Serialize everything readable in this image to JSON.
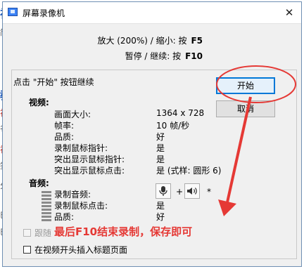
{
  "background": {
    "fragments": [
      "视",
      "简",
      "教",
      "视",
      "名",
      "视",
      "签",
      "分",
      "巳",
      "巳"
    ]
  },
  "dialog": {
    "title": "屏幕录像机",
    "close_glyph": "✕",
    "hotkeys": {
      "zoom_label": "放大 (200%) / 缩小: 按",
      "zoom_key": "F5",
      "pause_label": "暂停 / 继续: 按",
      "pause_key": "F10"
    },
    "prompt": "点击 \"开始\" 按钮继续",
    "buttons": {
      "start": "开始",
      "cancel": "取消"
    },
    "video": {
      "heading": "视频:",
      "rows": [
        {
          "label": "画面大小:",
          "value": "1364 x 728"
        },
        {
          "label": "帧率:",
          "value": "10 帧/秒"
        },
        {
          "label": "品质:",
          "value": "好"
        },
        {
          "label": "录制鼠标指针:",
          "value": "是"
        },
        {
          "label": "突出显示鼠标指针:",
          "value": "是"
        },
        {
          "label": "突出显示鼠标点击:",
          "value": "是 (式样: 圆形 6)"
        }
      ]
    },
    "audio": {
      "heading": "音频:",
      "rows": [
        {
          "label": "录制音频:",
          "value": ""
        },
        {
          "label": "录制鼠标点击:",
          "value": "是"
        },
        {
          "label": "品质:",
          "value": "好"
        }
      ],
      "plus": "+",
      "asterisk": "*",
      "mic_icon": "microphone-icon",
      "speaker_icon": "speaker-icon"
    },
    "checkboxes": [
      {
        "label": "跟随",
        "checked": false,
        "disabled": true
      },
      {
        "label": "在视频开头插入标题页面",
        "checked": false,
        "disabled": false
      }
    ]
  },
  "annotation": {
    "text": "最后F10结束录制，保存即可",
    "color": "#e53935"
  },
  "colors": {
    "accent": "#0078d7",
    "annotation": "#e53935"
  }
}
